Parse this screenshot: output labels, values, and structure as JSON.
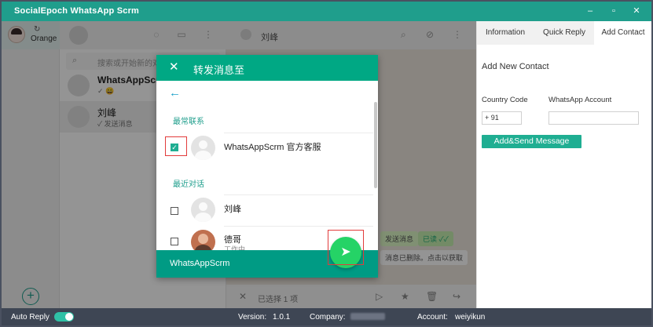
{
  "window": {
    "title": "SocialEpoch WhatsApp Scrm",
    "controls": [
      "–",
      "▫",
      "✕"
    ]
  },
  "rail": {
    "account_name": "Orange",
    "refresh_icon": "refresh-icon",
    "add_label": "+"
  },
  "chat_list": {
    "search_placeholder": "搜索或开始新的对话",
    "items": [
      {
        "name": "WhatsAppScrm",
        "preview": "✓ 😀"
      },
      {
        "name": "刘峰",
        "preview": "✓ 发送消息"
      }
    ]
  },
  "chat_panel": {
    "contact_name": "刘峰",
    "bubble_out": "发送消息",
    "bubble_tag": "已读 ✓✓",
    "bubble_in": "消息已删除。点击以获取",
    "selected_text": "已选择 1 项"
  },
  "right_panel": {
    "tabs": [
      "Information",
      "Quick Reply",
      "Add Contact"
    ],
    "active_tab": 2,
    "heading": "Add New Contact",
    "country_code_label": "Country Code",
    "country_code_value": "+ 91",
    "account_label": "WhatsApp Account",
    "account_value": "",
    "submit_label": "Add&Send Message"
  },
  "modal": {
    "title": "转发消息至",
    "section_frequent": "最常联系",
    "section_recent": "最近对话",
    "contacts": [
      {
        "name": "WhatsAppScrm 官方客服",
        "status": "",
        "checked": true
      },
      {
        "name": "刘峰",
        "status": "",
        "checked": false
      },
      {
        "name": "德哥",
        "status": "工作中",
        "checked": false
      }
    ],
    "footer_name": "WhatsAppScrm",
    "send_icon": "send-icon"
  },
  "status_bar": {
    "auto_reply_label": "Auto Reply",
    "auto_reply_on": true,
    "version_label": "Version:",
    "version_value": "1.0.1",
    "company_label": "Company:",
    "account_label": "Account:",
    "account_value": "weiyikun"
  },
  "colors": {
    "title_bar": "#1f9e8c",
    "modal_header": "#00a884",
    "send_button": "#25d366",
    "highlight": "#e23b3b",
    "status_bar": "#3e4654"
  }
}
